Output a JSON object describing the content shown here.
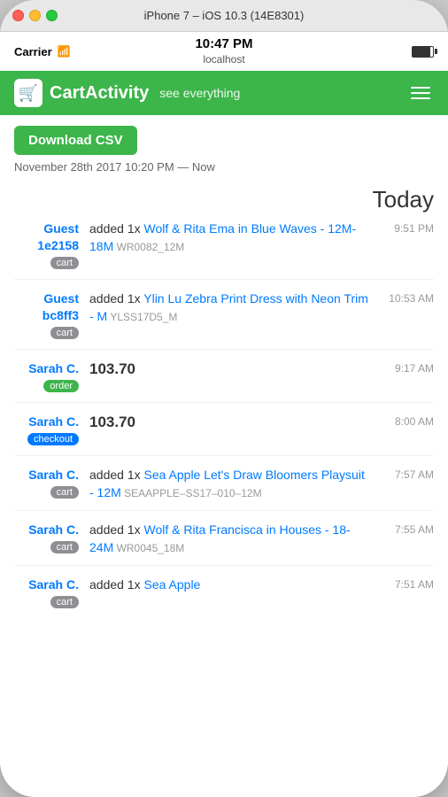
{
  "titlebar": {
    "title": "iPhone 7 – iOS 10.3 (14E8301)"
  },
  "statusbar": {
    "carrier": "Carrier",
    "time": "10:47 PM",
    "url": "localhost"
  },
  "header": {
    "logo": "🛒",
    "app_name": "CartActivity",
    "subtitle": "see everything",
    "menu_label": "Menu"
  },
  "content": {
    "download_btn": "Download CSV",
    "date_range": "November 28th 2017 10:20 PM — Now",
    "today_heading": "Today",
    "activities": [
      {
        "user": "Guest 1e2158",
        "badge": "cart",
        "badge_type": "cart",
        "text_prefix": "added 1x ",
        "product": "Wolf & Rita Ema in Blue Waves - 12M-18M",
        "sku": "WR0082_12M",
        "time": "9:51 PM",
        "is_amount": false
      },
      {
        "user": "Guest bc8ff3",
        "badge": "cart",
        "badge_type": "cart",
        "text_prefix": "added 1x ",
        "product": "Ylin Lu Zebra Print Dress with Neon Trim - M",
        "sku": "YLSS17D5_M",
        "time": "10:53 AM",
        "is_amount": false
      },
      {
        "user": "Sarah C.",
        "badge": "order",
        "badge_type": "order",
        "amount": "103.70",
        "time": "9:17 AM",
        "is_amount": true
      },
      {
        "user": "Sarah C.",
        "badge": "checkout",
        "badge_type": "checkout",
        "amount": "103.70",
        "time": "8:00 AM",
        "is_amount": true
      },
      {
        "user": "Sarah C.",
        "badge": "cart",
        "badge_type": "cart",
        "text_prefix": "added 1x ",
        "product": "Sea Apple Let's Draw Bloomers Playsuit - 12M",
        "sku": "SEAAPPLE–SS17–010–12M",
        "time": "7:57 AM",
        "is_amount": false
      },
      {
        "user": "Sarah C.",
        "badge": "cart",
        "badge_type": "cart",
        "text_prefix": "added 1x ",
        "product": "Wolf & Rita Francisca in Houses - 18-24M",
        "sku": "WR0045_18M",
        "time": "7:55 AM",
        "is_amount": false
      },
      {
        "user": "Sarah C.",
        "badge": "cart",
        "badge_type": "cart",
        "text_prefix": "added 1x ",
        "product": "Sea Apple",
        "sku": "",
        "time": "7:51 AM",
        "is_amount": false
      }
    ]
  }
}
